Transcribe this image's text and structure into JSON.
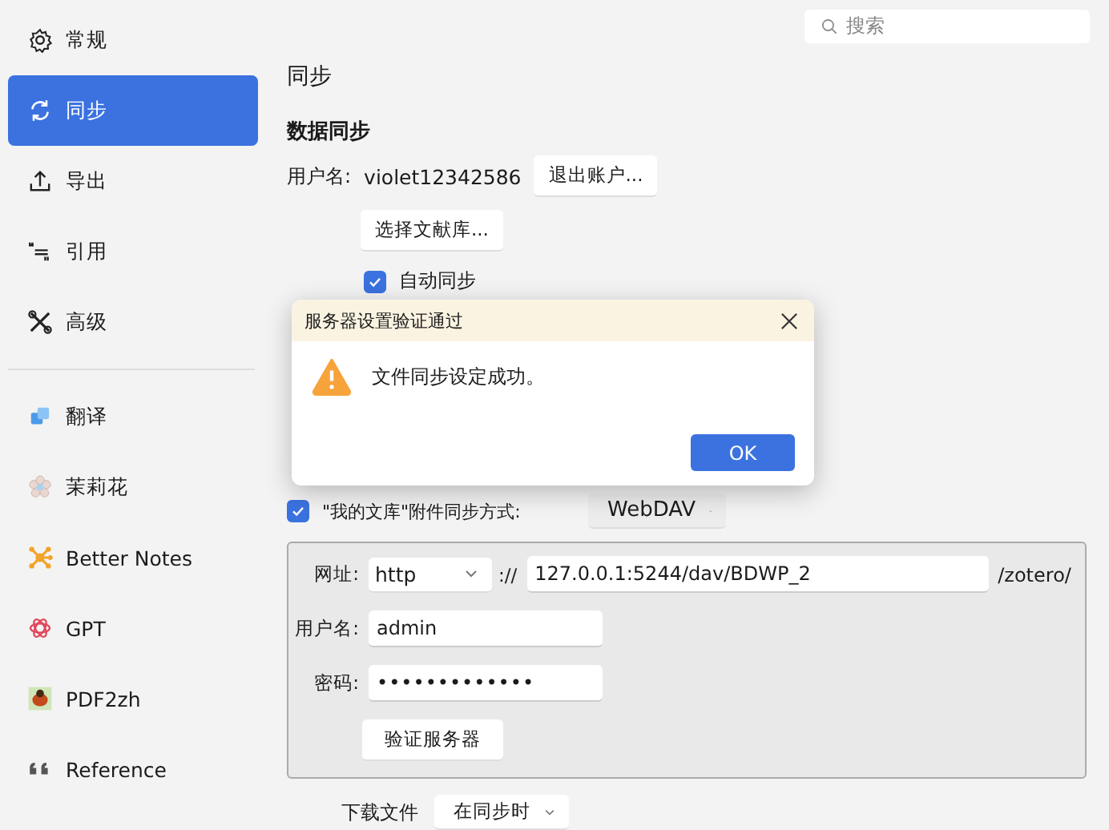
{
  "sidebar": {
    "main_items": [
      {
        "label": "常规",
        "kind": "gear",
        "selected": false
      },
      {
        "label": "同步",
        "kind": "sync",
        "selected": true
      },
      {
        "label": "导出",
        "kind": "export",
        "selected": false
      },
      {
        "label": "引用",
        "kind": "cite",
        "selected": false
      },
      {
        "label": "高级",
        "kind": "tools",
        "selected": false
      }
    ],
    "plugin_items": [
      {
        "label": "翻译",
        "kind": "translate",
        "selected": false
      },
      {
        "label": "茉莉花",
        "kind": "flower",
        "selected": false
      },
      {
        "label": "Better Notes",
        "kind": "notes",
        "selected": false
      },
      {
        "label": "GPT",
        "kind": "gpt",
        "selected": false
      },
      {
        "label": "PDF2zh",
        "kind": "pdf2zh",
        "selected": false
      },
      {
        "label": "Reference",
        "kind": "quote",
        "selected": false
      }
    ]
  },
  "search": {
    "placeholder": "搜索"
  },
  "page_title": "同步",
  "data_sync": {
    "heading": "数据同步",
    "username_label": "用户名:",
    "username": "violet12342586",
    "logout_button": "退出账户...",
    "choose_library_button": "选择文献库...",
    "auto_sync": {
      "label": "自动同步",
      "checked": true
    }
  },
  "file_sync": {
    "my_library": {
      "label": "\"我的文库\"附件同步方式:",
      "checked": true
    },
    "method": "WebDAV",
    "url_label": "网址:",
    "protocol": "http",
    "separator": "://",
    "url": "127.0.0.1:5244/dav/BDWP_2",
    "suffix": "/zotero/",
    "username_label": "用户名:",
    "username": "admin",
    "password_label": "密码:",
    "password": "•••••••••••••",
    "verify_button": "验证服务器",
    "download_label": "下载文件",
    "download_option": "在同步时"
  },
  "dialog": {
    "title": "服务器设置验证通过",
    "message": "文件同步设定成功。",
    "ok_button": "OK"
  }
}
